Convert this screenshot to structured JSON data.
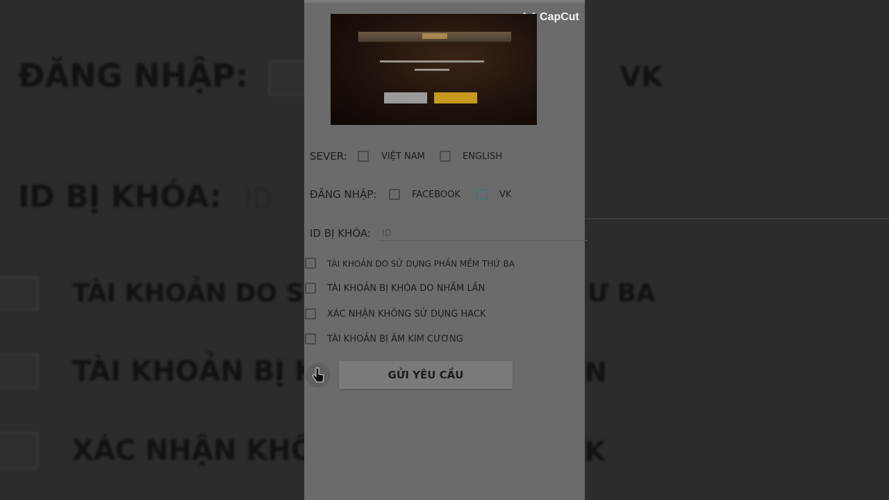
{
  "watermark": {
    "text": "CapCut",
    "icon": "capcut-logo-icon"
  },
  "background": {
    "login_label": "ĐĂNG NHẬP:",
    "vk_label": "VK",
    "id_label": "ID BỊ KHÓA:",
    "id_placeholder": "ID",
    "reason1_fragment_left": "TÀI KHOẢN DO SỬ",
    "reason1_fragment_right": "Ư BA",
    "reason2_fragment": "TÀI KHOẢN BỊ K",
    "reason2_fragment_right": "N",
    "reason3_fragment": "XÁC NHẬN KHÔ",
    "reason3_fragment_right": "K"
  },
  "thumbnail": {
    "icon": "game-dialog-preview"
  },
  "form": {
    "server_label": "SEVER:",
    "server_options": [
      {
        "label": "VIỆT NAM",
        "checked": false
      },
      {
        "label": "ENGLISH",
        "checked": false
      }
    ],
    "login_label": "ĐĂNG NHẬP:",
    "login_options": [
      {
        "label": "FACEBOOK",
        "checked": false
      },
      {
        "label": "VK",
        "checked": false
      }
    ],
    "id_label": "ID BỊ KHÓA:",
    "id_placeholder": "ID",
    "id_value": "",
    "reasons": [
      {
        "label": "TÀI KHOẢN DO SỬ DỤNG PHẦN MỀM THỨ BA",
        "checked": false
      },
      {
        "label": "TÀI KHOẢN BỊ KHÓA DO NHẦM LẦN",
        "checked": false
      },
      {
        "label": "XÁC NHẬN KHÔNG SỬ DỤNG HACK",
        "checked": false
      },
      {
        "label": "TÀI KHOẢN BỊ ÂM KIM CƯƠNG",
        "checked": false
      }
    ],
    "submit_label": "GỬI YÊU CẦU"
  },
  "colors": {
    "panel_bg": "#6b6b6b",
    "page_bg": "#2c2c2c",
    "submit_bg": "#7a7a7a",
    "thumb_accent": "#c69a1e"
  }
}
